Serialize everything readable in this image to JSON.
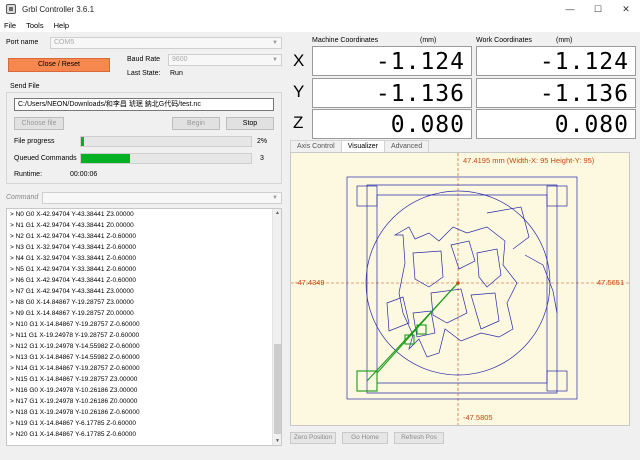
{
  "window": {
    "title": "Grbl Controller 3.6.1",
    "minimize": "—",
    "maximize": "☐",
    "close": "✕"
  },
  "menu": [
    "File",
    "Tools",
    "Help"
  ],
  "port": {
    "label": "Port name",
    "value": "COM5"
  },
  "baud": {
    "label": "Baud Rate",
    "value": "9600"
  },
  "close_reset_label": "Close / Reset",
  "last_state": {
    "label": "Last State:",
    "value": "Run"
  },
  "send_file": {
    "group_label": "Send File",
    "path": "C:/Users/NEON/Downloads/和李昌 琥珉 鈉北G代码/test.nc",
    "choose_label": "Choose file",
    "begin_label": "Begin",
    "stop_label": "Stop"
  },
  "file_progress": {
    "label": "File progress",
    "percent_text": "2%",
    "fraction": 0.02
  },
  "queued": {
    "label": "Queued Commands",
    "count": "3",
    "fraction": 0.29
  },
  "runtime": {
    "label": "Runtime:",
    "value": "00:00:06"
  },
  "command": {
    "label": "Command",
    "value": ""
  },
  "log_lines": [
    "> N0 G0 X-42.94704 Y-43.38441 Z3.00000",
    "> N1 G1 X-42.94704 Y-43.38441 Z0.00000",
    "> N2 G1 X-42.94704 Y-43.38441 Z-0.60000",
    "> N3 G1 X-32.94704 Y-43.38441 Z-0.60000",
    "> N4 G1 X-32.94704 Y-33.38441 Z-0.60000",
    "> N5 G1 X-42.94704 Y-33.38441 Z-0.60000",
    "> N6 G1 X-42.94704 Y-43.38441 Z-0.60000",
    "> N7 G1 X-42.94704 Y-43.38441 Z3.00000",
    "> N8 G0 X-14.84867 Y-19.28757 Z3.00000",
    "> N9 G1 X-14.84867 Y-19.28757 Z0.00000",
    "> N10 G1 X-14.84867 Y-19.28757 Z-0.60000",
    "> N11 G1 X-19.24978 Y-19.28757 Z-0.60000",
    "> N12 G1 X-19.24978 Y-14.55982 Z-0.60000",
    "> N13 G1 X-14.84867 Y-14.55982 Z-0.60000",
    "> N14 G1 X-14.84867 Y-19.28757 Z-0.60000",
    "> N15 G1 X-14.84867 Y-19.28757 Z3.00000",
    "> N16 G0 X-19.24978 Y-10.26186 Z3.00000",
    "> N17 G1 X-19.24978 Y-10.26186 Z0.00000",
    "> N18 G1 X-19.24978 Y-10.26186 Z-0.60000",
    "> N19 G1 X-14.84867 Y-6.17785 Z-0.60000",
    "> N20 G1 X-14.84867 Y-6.17785 Z-0.60000"
  ],
  "coords": {
    "machine_label": "Machine Coordinates",
    "work_label": "Work Coordinates",
    "unit": "(mm)",
    "axes": [
      {
        "axis": "X",
        "machine": "-1.124",
        "work": "-1.124"
      },
      {
        "axis": "Y",
        "machine": "-1.136",
        "work": "-1.136"
      },
      {
        "axis": "Z",
        "machine": "0.080",
        "work": "0.080"
      }
    ]
  },
  "tabs": [
    "Axis Control",
    "Visualizer",
    "Advanced"
  ],
  "active_tab": "Visualizer",
  "visualizer": {
    "header": "47.4195 mm  (Width-X: 95  Height-Y: 95)",
    "x_min": "-47.4349",
    "x_max": "47.5651",
    "y_min": "-47.5805",
    "colors": {
      "background": "#fcf9e0",
      "toolpath": "#2a2aa8",
      "progress": "#1a9a1a",
      "axis_label": "#c24a10"
    }
  },
  "bottom_buttons": [
    "Zero Position",
    "Go Home",
    "Refresh Pos"
  ]
}
